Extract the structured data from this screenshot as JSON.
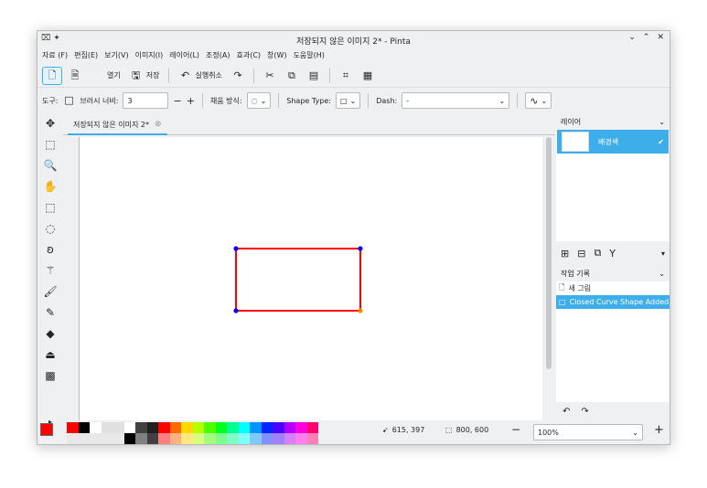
{
  "window": {
    "title": "저장되지 않은 이미지 2* - Pinta",
    "left_icons": "⌧ ✦",
    "controls": [
      "⌄",
      "⌃",
      "✕"
    ]
  },
  "menu": [
    "자료 (F)",
    "편집(E)",
    "보기(V)",
    "이미지(I)",
    "레이어(L)",
    "조정(A)",
    "효과(C)",
    "창(W)",
    "도움말(H)"
  ],
  "toolbar": {
    "open_label": "열기",
    "save_label": "저장",
    "undo_label": "실행취소"
  },
  "options": {
    "tool_label": "도구:",
    "brush_width_label": "브러시 너비:",
    "brush_width_value": "3",
    "minus": "−",
    "plus": "+",
    "fill_label": "채움 방식:",
    "shape_type_label": "Shape Type:",
    "dash_label": "Dash:",
    "dash_value": "-"
  },
  "tab": {
    "label": "저장되지 않은 이미지 2*"
  },
  "layers": {
    "header": "레이어",
    "items": [
      {
        "name": "배경색"
      }
    ]
  },
  "history": {
    "header": "작업 기록",
    "items": [
      {
        "label": "새 그림",
        "selected": false
      },
      {
        "label": "Closed Curve Shape Added",
        "selected": true
      }
    ]
  },
  "status": {
    "cursor_pos": "615, 397",
    "image_size": "800, 600",
    "zoom": "100%"
  },
  "palette": {
    "primary": "#ff0000",
    "secondary": "#000000",
    "row1": [
      "#ff0000",
      "#000000",
      "#ffffff",
      "#e0e0e0",
      "#e0e0e0",
      "#ffffff",
      "#404040",
      "#202020",
      "#ff0000",
      "#ff6a00",
      "#ffd800",
      "#b6ff00",
      "#4cff00",
      "#00ff21",
      "#00ff90",
      "#00ffff",
      "#0094ff",
      "#0026ff",
      "#4800ff",
      "#b200ff",
      "#ff00dc",
      "#ff006e"
    ],
    "row2": [
      "#e8e8e8",
      "#e8e8e8",
      "#e8e8e8",
      "#e8e8e8",
      "#e8e8e8",
      "#000000",
      "#808080",
      "#404040",
      "#ff7f7f",
      "#ffb27f",
      "#ffe97f",
      "#daff7f",
      "#a5ff7f",
      "#7fff8e",
      "#7fffc5",
      "#7fffff",
      "#7fc9ff",
      "#7f92ff",
      "#a17fff",
      "#d67fff",
      "#ff7fed",
      "#ff7fb6"
    ]
  },
  "shape": {
    "stroke": "#ff0000",
    "handle_color": "#0000ff",
    "active_handle_color": "#ff8c00"
  }
}
